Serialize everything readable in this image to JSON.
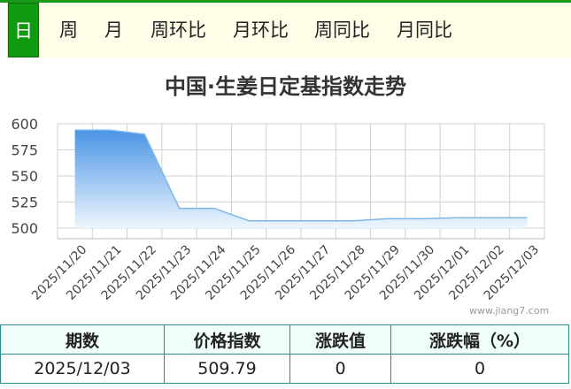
{
  "tabs": [
    {
      "label": "日",
      "active": true
    },
    {
      "label": "周",
      "active": false
    },
    {
      "label": "月",
      "active": false
    },
    {
      "label": "周环比",
      "active": false
    },
    {
      "label": "月环比",
      "active": false
    },
    {
      "label": "周同比",
      "active": false
    },
    {
      "label": "月同比",
      "active": false
    }
  ],
  "chart_data": {
    "type": "area",
    "title": "中国·生姜日定基指数走势",
    "xlabel": "",
    "ylabel": "",
    "x": [
      "2025/11/20",
      "2025/11/21",
      "2025/11/22",
      "2025/11/23",
      "2025/11/24",
      "2025/11/25",
      "2025/11/26",
      "2025/11/27",
      "2025/11/28",
      "2025/11/29",
      "2025/11/30",
      "2025/12/01",
      "2025/12/02",
      "2025/12/03"
    ],
    "values": [
      594,
      594,
      590,
      519,
      519,
      507,
      507,
      507,
      507,
      509,
      509,
      510,
      510,
      510
    ],
    "yticks": [
      500,
      525,
      550,
      575,
      600
    ],
    "ylim": [
      500,
      600
    ],
    "grid": true,
    "colors": {
      "line": "#7fb8e8",
      "fill_top": "#4a94e6",
      "fill_bottom": "#eef6fd",
      "grid": "#d0d0d0"
    }
  },
  "watermark": "www.jiang7.com",
  "summary": {
    "headers": [
      "期数",
      "价格指数",
      "涨跌值",
      "涨跌幅（%）"
    ],
    "row": [
      "2025/12/03",
      "509.79",
      "0",
      "0"
    ]
  }
}
